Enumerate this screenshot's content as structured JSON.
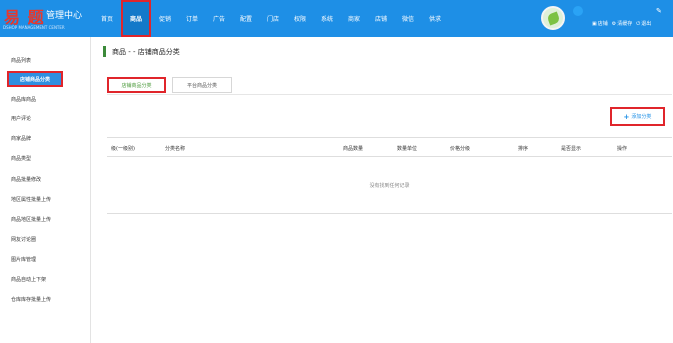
{
  "header": {
    "logo_main": "易 题",
    "logo_title": "管理中心",
    "logo_sub": "DSHOP MANAGEMENT CENTER",
    "nav": [
      "首页",
      "商品",
      "促销",
      "订单",
      "广告",
      "配置",
      "门店",
      "权限",
      "系统",
      "商家",
      "店铺",
      "微信",
      "供求"
    ],
    "active_nav": "商品",
    "actions": {
      "shop": "店铺",
      "cache": "清缓存",
      "logout": "退出"
    }
  },
  "sidebar": {
    "items": [
      "商品列表",
      "店铺商品分类",
      "商品库商品",
      "用户评论",
      "商家品牌",
      "商品类型",
      "商品批量修改",
      "地区属性批量上传",
      "商品地区批量上传",
      "网友讨论圈",
      "图片库管理",
      "商品自动上下架",
      "仓库库存批量上传"
    ],
    "active": "店铺商品分类"
  },
  "main": {
    "breadcrumb": "商品 - - 店铺商品分类",
    "tabs": [
      "店铺商品分类",
      "平台商品分类"
    ],
    "add_button": "添加分类",
    "columns": [
      "级(一级别)",
      "分类名称",
      "商品数量",
      "数量单位",
      "价格分级",
      "排序",
      "是否显示",
      "操作"
    ],
    "empty_text": "没有找到任何记录"
  },
  "colors": {
    "header_bg": "#1e8fe6",
    "highlight_border": "#e0252b",
    "active_sidebar_bg": "#2f8fe0",
    "active_tab_text": "#4a9a3a"
  }
}
